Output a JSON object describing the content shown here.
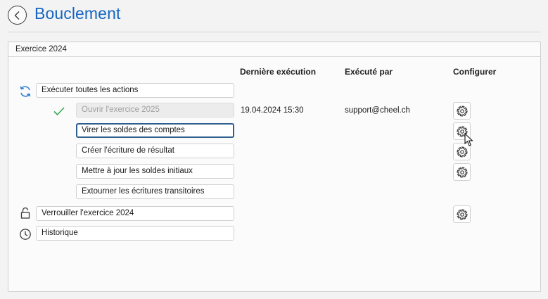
{
  "header": {
    "title": "Bouclement"
  },
  "panel": {
    "title": "Exercice 2024",
    "columns": {
      "last_run": "Dernière exécution",
      "run_by": "Exécuté par",
      "configure": "Configurer"
    },
    "actions": {
      "run_all": "Exécuter toutes les actions",
      "open_next_year": "Ouvrir l'exercice 2025",
      "transfer_balances": "Virer les soldes des comptes",
      "create_result_entry": "Créer l'écriture de résultat",
      "update_opening_balances": "Mettre à jour les soldes initiaux",
      "reverse_transitory_entries": "Extourner les écritures transitoires",
      "lock_year": "Verrouiller l'exercice 2024",
      "history": "Historique"
    },
    "open_next_year_last_run": "19.04.2024 15:30",
    "open_next_year_run_by": "support@cheel.ch",
    "open_next_year_status": "completed"
  },
  "colors": {
    "accent": "#1565c0",
    "sync_icon": "#2b7fd3",
    "check": "#3aa454",
    "focus_border": "#2e5f8f"
  }
}
